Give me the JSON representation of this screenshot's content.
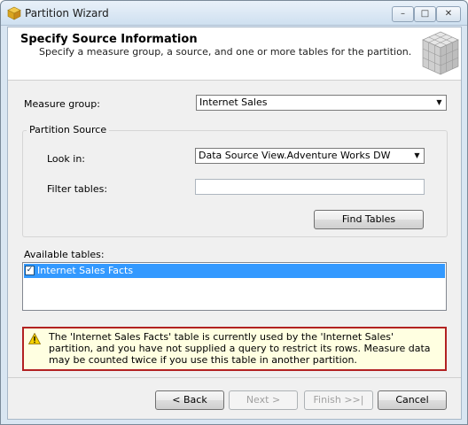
{
  "window": {
    "title": "Partition Wizard",
    "minimize_glyph": "–",
    "maximize_glyph": "□",
    "close_glyph": "✕"
  },
  "header": {
    "title": "Specify Source Information",
    "subtitle": "Specify a measure group, a source, and one or more tables for the partition."
  },
  "measure_group": {
    "label": "Measure group:",
    "value": "Internet Sales"
  },
  "partition_source": {
    "group_label": "Partition Source",
    "look_in_label": "Look in:",
    "look_in_value": "Data Source View.Adventure Works DW",
    "filter_label": "Filter tables:",
    "filter_value": "",
    "find_tables_button": "Find Tables"
  },
  "available_tables": {
    "label": "Available tables:",
    "items": [
      {
        "name": "Internet Sales Facts",
        "checked": true,
        "check_glyph": "✓"
      }
    ]
  },
  "warning": {
    "icon": "warning-icon",
    "text": "The 'Internet Sales Facts' table is currently used by the 'Internet Sales' partition, and you have not supplied a query to restrict its rows. Measure data may be counted twice if you use this table in another partition."
  },
  "buttons": {
    "back": "< Back",
    "next": "Next >",
    "finish": "Finish >>|",
    "cancel": "Cancel"
  },
  "colors": {
    "selection": "#3399ff",
    "warning_border": "#b22222",
    "warning_background": "#ffffe1"
  }
}
